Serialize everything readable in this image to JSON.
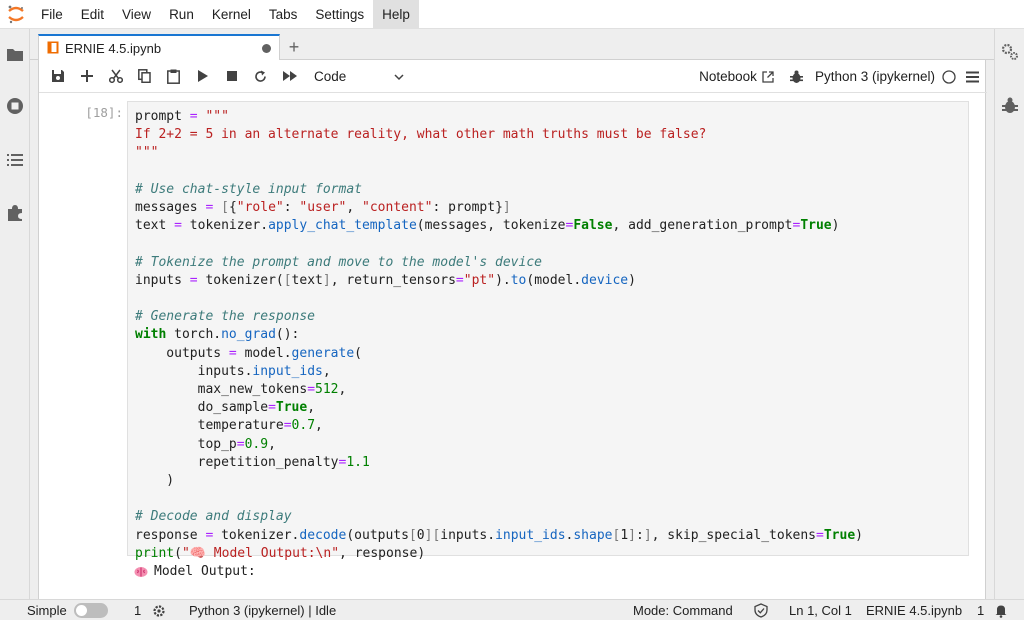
{
  "menu": {
    "items": [
      "File",
      "Edit",
      "View",
      "Run",
      "Kernel",
      "Tabs",
      "Settings",
      "Help"
    ],
    "active": "Help"
  },
  "tab": {
    "title": "ERNIE 4.5.ipynb",
    "add_label": "+"
  },
  "toolbar": {
    "cell_type": "Code",
    "notebook_label": "Notebook",
    "kernel": "Python 3 (ipykernel)"
  },
  "cell": {
    "prompt": "[18]:",
    "code_lines": [
      "prompt = \"\"\"",
      "If 2+2 = 5 in an alternate reality, what other math truths must be false?",
      "\"\"\"",
      "",
      "# Use chat-style input format",
      "messages = [{\"role\": \"user\", \"content\": prompt}]",
      "text = tokenizer.apply_chat_template(messages, tokenize=False, add_generation_prompt=True)",
      "",
      "# Tokenize the prompt and move to the model's device",
      "inputs = tokenizer([text], return_tensors=\"pt\").to(model.device)",
      "",
      "# Generate the response",
      "with torch.no_grad():",
      "    outputs = model.generate(",
      "        inputs.input_ids,",
      "        max_new_tokens=512,",
      "        do_sample=True,",
      "        temperature=0.7,",
      "        top_p=0.9,",
      "        repetition_penalty=1.1",
      "    )",
      "",
      "# Decode and display",
      "response = tokenizer.decode(outputs[0][inputs.input_ids.shape[1]:], skip_special_tokens=True)",
      "print(\"🧠 Model Output:\\n\", response)"
    ],
    "output_text": "Model Output:"
  },
  "status": {
    "mode_label": "Simple",
    "terminals": "1",
    "kernel_status": "Python 3 (ipykernel) | Idle",
    "mode": "Mode: Command",
    "position": "Ln 1, Col 1",
    "file": "ERNIE 4.5.ipynb",
    "notifications": "1"
  },
  "colors": {
    "accent": "#1976d2",
    "keyword": "#008000",
    "string": "#ba2121",
    "comment": "#3d7b7b"
  }
}
